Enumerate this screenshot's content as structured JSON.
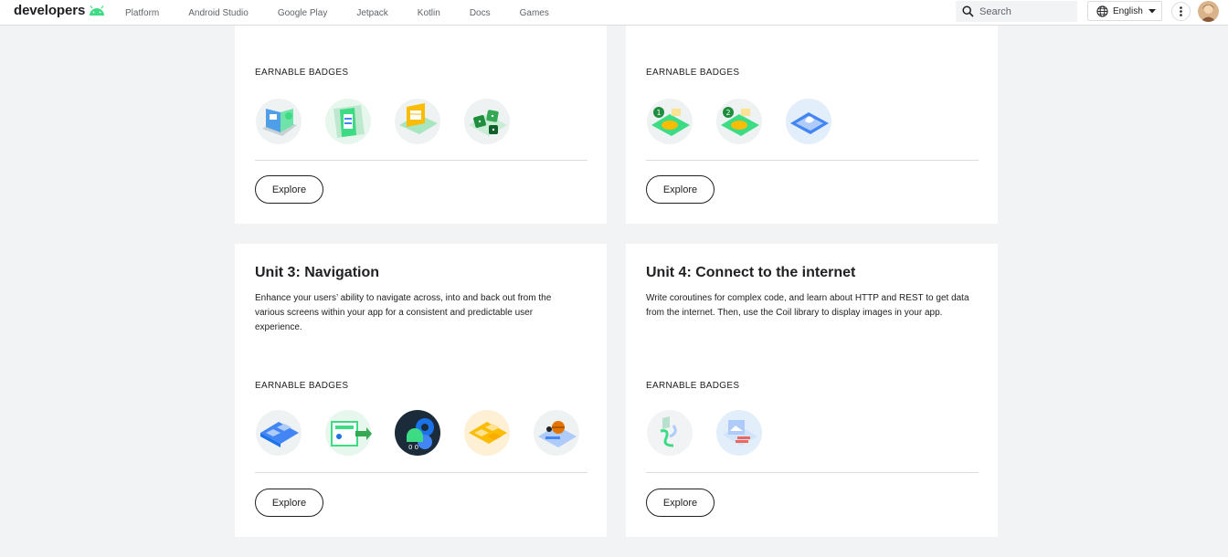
{
  "header": {
    "logo_text": "developers",
    "nav": [
      "Platform",
      "Android Studio",
      "Google Play",
      "Jetpack",
      "Kotlin",
      "Docs",
      "Games"
    ],
    "search_placeholder": "Search",
    "language": "English",
    "colors": {
      "android_green": "#3ddc84",
      "text": "#202124",
      "muted": "#5f6368"
    }
  },
  "cards": [
    {
      "badges_label": "EARNABLE BADGES",
      "badges": [
        "laptop-badge-icon",
        "phone-list-badge-icon",
        "tablet-calendar-badge-icon",
        "dice-badge-icon"
      ],
      "explore_label": "Explore"
    },
    {
      "badges_label": "EARNABLE BADGES",
      "badges": [
        "tip-calculator-1-badge-icon",
        "tip-calculator-2-badge-icon",
        "water-tablet-badge-icon"
      ],
      "explore_label": "Explore"
    },
    {
      "title": "Unit 3: Navigation",
      "description": "Enhance your users’ ability to navigate across, into and back out from the various screens within your app for a consistent and predictable user experience.",
      "badges_label": "EARNABLE BADGES",
      "badges": [
        "grid-tablet-badge-icon",
        "navigation-arrow-badge-icon",
        "android-gears-badge-icon",
        "cupcake-grid-badge-icon",
        "sports-tablet-badge-icon"
      ],
      "explore_label": "Explore"
    },
    {
      "title": "Unit 4: Connect to the internet",
      "description": "Write coroutines for complex code, and learn about HTTP and REST to get data from the internet. Then, use the Coil library to display images in your app.",
      "badges_label": "EARNABLE BADGES",
      "badges": [
        "coroutine-flow-badge-icon",
        "internet-image-badge-icon"
      ],
      "explore_label": "Explore"
    }
  ]
}
